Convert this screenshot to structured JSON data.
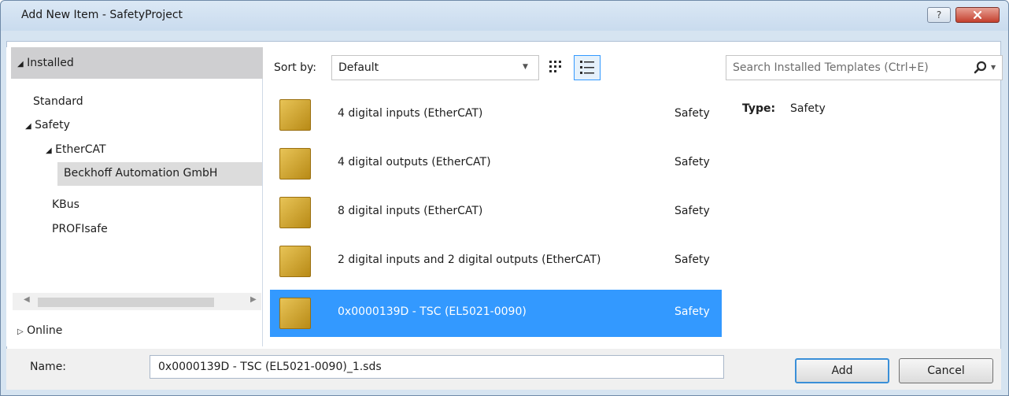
{
  "window": {
    "title": "Add New Item - SafetyProject",
    "help_glyph": "?",
    "close_glyph": "✕"
  },
  "left_panel": {
    "installed_label": "Installed",
    "tree": {
      "standard": "Standard",
      "safety": "Safety",
      "ethercat": "EtherCAT",
      "beckhoff": "Beckhoff Automation GmbH",
      "kbus": "KBus",
      "profisafe": "PROFIsafe"
    },
    "online_label": "Online"
  },
  "toolbar": {
    "sort_label": "Sort by:",
    "sort_value": "Default"
  },
  "items": [
    {
      "name": "4 digital inputs (EtherCAT)",
      "category": "Safety"
    },
    {
      "name": "4 digital outputs (EtherCAT)",
      "category": "Safety"
    },
    {
      "name": "8 digital inputs (EtherCAT)",
      "category": "Safety"
    },
    {
      "name": "2 digital inputs and 2 digital outputs (EtherCAT)",
      "category": "Safety"
    },
    {
      "name": "0x0000139D - TSC (EL5021-0090)",
      "category": "Safety",
      "selected": true
    }
  ],
  "search": {
    "placeholder": "Search Installed Templates (Ctrl+E)"
  },
  "details": {
    "type_label": "Type:",
    "type_value": "Safety"
  },
  "footer": {
    "name_label": "Name:",
    "name_value": "0x0000139D - TSC (EL5021-0090)_1.sds",
    "add_label": "Add",
    "cancel_label": "Cancel"
  },
  "colors": {
    "selection": "#3399ff",
    "title_bg": "#d6e4f1",
    "close": "#c4402e"
  }
}
